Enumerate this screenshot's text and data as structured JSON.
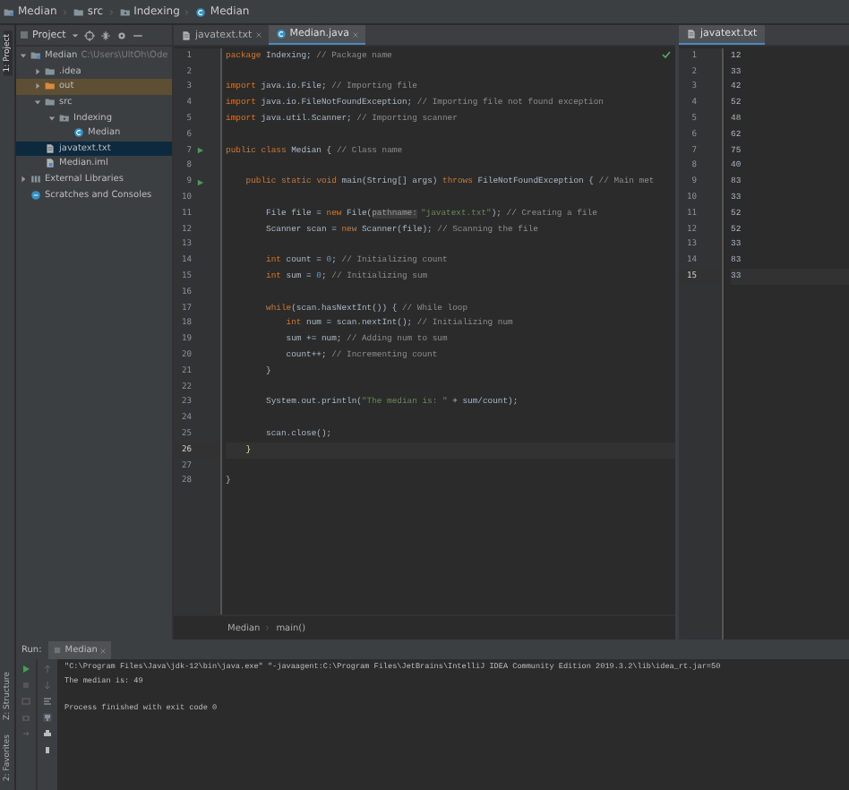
{
  "nav_bar": {
    "crumbs": [
      {
        "label": "Median",
        "kind": "module"
      },
      {
        "label": "src",
        "kind": "folder"
      },
      {
        "label": "Indexing",
        "kind": "package"
      },
      {
        "label": "Median",
        "kind": "class"
      }
    ]
  },
  "left_stripe": {
    "top": [
      "1: Project"
    ],
    "bottom": [
      "Z: Structure",
      "2: Favorites"
    ]
  },
  "project": {
    "title": "Project",
    "tree": [
      {
        "label": "Median",
        "detail": "C:\\Users\\UltOh\\Ode",
        "kind": "module",
        "expanded": true,
        "selected": false,
        "tinted": false,
        "children": [
          {
            "label": ".idea",
            "kind": "folder",
            "expanded": false,
            "selected": false,
            "tinted": false
          },
          {
            "label": "out",
            "kind": "excluded",
            "expanded": false,
            "selected": false,
            "tinted": true
          },
          {
            "label": "src",
            "kind": "folder",
            "expanded": true,
            "selected": false,
            "tinted": false,
            "children": [
              {
                "label": "Indexing",
                "kind": "package",
                "expanded": true,
                "selected": false,
                "tinted": false,
                "children": [
                  {
                    "label": "Median",
                    "kind": "class",
                    "selected": false,
                    "tinted": false
                  }
                ]
              }
            ]
          },
          {
            "label": "javatext.txt",
            "kind": "text",
            "selected": true,
            "tinted": false
          },
          {
            "label": "Median.iml",
            "kind": "iml",
            "selected": false,
            "tinted": false
          }
        ]
      },
      {
        "label": "External Libraries",
        "kind": "library",
        "expanded": false,
        "selected": false,
        "tinted": false
      },
      {
        "label": "Scratches and Consoles",
        "kind": "scratch",
        "selected": false,
        "tinted": false
      }
    ]
  },
  "editor": {
    "tabs": [
      {
        "label": "javatext.txt",
        "kind": "text",
        "selected": false
      },
      {
        "label": "Median.java",
        "kind": "class",
        "selected": true
      }
    ],
    "lines": [
      {
        "number": "1",
        "current": false,
        "text": "package Indexing; // Package name"
      },
      {
        "number": "2",
        "current": false
      },
      {
        "number": "3",
        "current": false,
        "text": "import java.io.File; // Importing file"
      },
      {
        "number": "4",
        "current": false,
        "text": "import java.io.FileNotFoundException; // Importing file not found exception"
      },
      {
        "number": "5",
        "current": false,
        "text": "import java.util.Scanner; // Importing scanner"
      },
      {
        "number": "6",
        "current": false
      },
      {
        "number": "7",
        "run": true,
        "current": false,
        "text": "public class Median { // Class name"
      },
      {
        "number": "8",
        "current": false
      },
      {
        "number": "9",
        "run": true,
        "current": false,
        "text": "    public static void main(String[] args) throws FileNotFoundException { // Main met"
      },
      {
        "number": "10",
        "current": false
      },
      {
        "number": "11",
        "current": false,
        "text": "        File file = new File(",
        "hint": "pathname:",
        "rest": "\"javatext.txt\"); // Creating a file"
      },
      {
        "number": "12",
        "current": false,
        "text": "        Scanner scan = new Scanner(file); // Scanning the file"
      },
      {
        "number": "13",
        "current": false
      },
      {
        "number": "14",
        "current": false,
        "text": "        int count = 0; // Initializing count"
      },
      {
        "number": "15",
        "current": false,
        "text": "        int sum = 0; // Initializing sum"
      },
      {
        "number": "16",
        "current": false
      },
      {
        "number": "17",
        "current": false,
        "text": "        while(scan.hasNextInt()) { // While loop"
      },
      {
        "number": "18",
        "current": false,
        "text": "            int num = scan.nextInt(); // Initializing num"
      },
      {
        "number": "19",
        "current": false,
        "text": "            sum += num; // Adding num to sum"
      },
      {
        "number": "20",
        "current": false,
        "text": "            count++; // Incrementing count"
      },
      {
        "number": "21",
        "current": false,
        "text": "        }"
      },
      {
        "number": "22",
        "current": false
      },
      {
        "number": "23",
        "current": false,
        "text": "        System.out.println(\"The median is: \" + sum/count);"
      },
      {
        "number": "24",
        "current": false
      },
      {
        "number": "25",
        "current": false,
        "text": "        scan.close();"
      },
      {
        "number": "26",
        "current": true,
        "text": "    }"
      },
      {
        "number": "27",
        "current": false
      },
      {
        "number": "28",
        "current": false,
        "text": "}"
      }
    ],
    "breadcrumbs": [
      "Median",
      "main()"
    ]
  },
  "text_view": {
    "tab": {
      "label": "javatext.txt",
      "kind": "text",
      "selected": true
    },
    "lines": [
      {
        "number": "1",
        "text": "12",
        "current": false
      },
      {
        "number": "2",
        "text": "33",
        "current": false
      },
      {
        "number": "3",
        "text": "42",
        "current": false
      },
      {
        "number": "4",
        "text": "52",
        "current": false
      },
      {
        "number": "5",
        "text": "48",
        "current": false
      },
      {
        "number": "6",
        "text": "62",
        "current": false
      },
      {
        "number": "7",
        "text": "75",
        "current": false
      },
      {
        "number": "8",
        "text": "40",
        "current": false
      },
      {
        "number": "9",
        "text": "83",
        "current": false
      },
      {
        "number": "10",
        "text": "33",
        "current": false
      },
      {
        "number": "11",
        "text": "52",
        "current": false
      },
      {
        "number": "12",
        "text": "52",
        "current": false
      },
      {
        "number": "13",
        "text": "33",
        "current": false
      },
      {
        "number": "14",
        "text": "83",
        "current": false
      },
      {
        "number": "15",
        "text": "33",
        "current": true
      }
    ]
  },
  "run_panel": {
    "label": "Run:",
    "tabs": [
      {
        "label": "Median",
        "selected": true
      }
    ],
    "output": [
      {
        "kind": "command",
        "text": "\"C:\\Program Files\\Java\\jdk-12\\bin\\java.exe\" \"-javaagent:C:\\Program Files\\JetBrains\\IntelliJ IDEA Community Edition 2019.3.2\\lib\\idea_rt.jar=50"
      },
      {
        "kind": "stdout",
        "text": "The median is: 49"
      },
      {
        "kind": "system",
        "text": "Process finished with exit code 0"
      }
    ]
  }
}
